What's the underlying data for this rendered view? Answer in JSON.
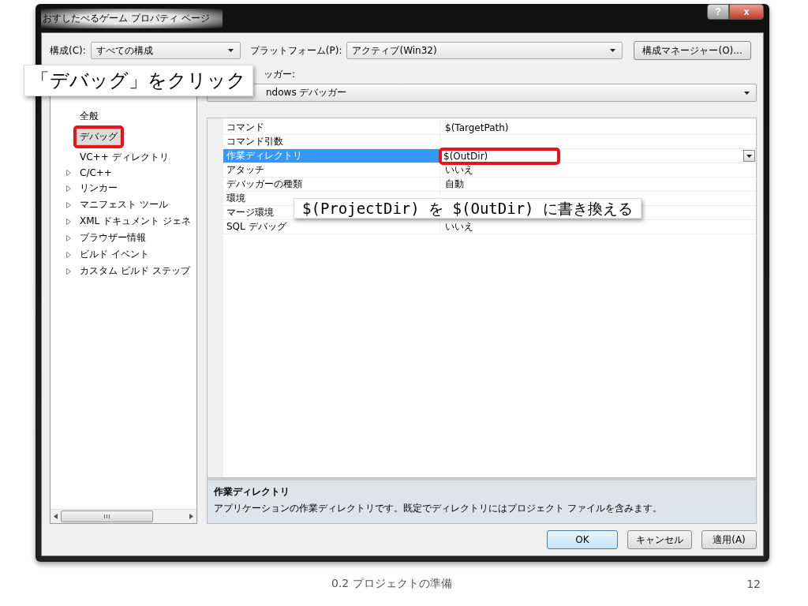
{
  "window": {
    "title": "おすしたべるゲーム プロパティ ページ",
    "controls": [
      {
        "kind": "help",
        "label": "?"
      },
      {
        "kind": "close",
        "label": "x"
      }
    ]
  },
  "toolbar": {
    "config_label": "構成(C):",
    "config_value": "すべての構成",
    "platform_label": "プラットフォーム(P):",
    "platform_value": "アクティブ(Win32)",
    "manager_button": "構成マネージャー(O)..."
  },
  "debugger": {
    "label": "ッガー:",
    "value": "ndows デバッガー"
  },
  "tree": {
    "items": [
      {
        "label": "全般",
        "expandable": false,
        "selected": false,
        "highlighted": false
      },
      {
        "label": "デバッグ",
        "expandable": false,
        "selected": true,
        "highlighted": true
      },
      {
        "label": "VC++ ディレクトリ",
        "expandable": false,
        "selected": false,
        "highlighted": false
      },
      {
        "label": "C/C++",
        "expandable": true,
        "selected": false,
        "highlighted": false
      },
      {
        "label": "リンカー",
        "expandable": true,
        "selected": false,
        "highlighted": false
      },
      {
        "label": "マニフェスト ツール",
        "expandable": true,
        "selected": false,
        "highlighted": false
      },
      {
        "label": "XML ドキュメント ジェネ",
        "expandable": true,
        "selected": false,
        "highlighted": false
      },
      {
        "label": "ブラウザー情報",
        "expandable": true,
        "selected": false,
        "highlighted": false
      },
      {
        "label": "ビルド イベント",
        "expandable": true,
        "selected": false,
        "highlighted": false
      },
      {
        "label": "カスタム ビルド ステップ",
        "expandable": true,
        "selected": false,
        "highlighted": false
      }
    ]
  },
  "properties": [
    {
      "name": "コマンド",
      "value": "$(TargetPath)",
      "selected": false,
      "highlighted": false
    },
    {
      "name": "コマンド引数",
      "selected": false,
      "highlighted": false
    },
    {
      "name": "作業ディレクトリ",
      "value": "$(OutDir)",
      "selected": true,
      "highlighted": true
    },
    {
      "name": "アタッチ",
      "value": "いいえ",
      "selected": false,
      "highlighted": false
    },
    {
      "name": "デバッガーの種類",
      "value": "自動",
      "selected": false,
      "highlighted": false
    },
    {
      "name": "環境",
      "selected": false,
      "highlighted": false
    },
    {
      "name": "マージ環境",
      "selected": false,
      "highlighted": false
    },
    {
      "name": "SQL デバッグ",
      "value": "いいえ",
      "selected": false,
      "highlighted": false
    }
  ],
  "description": {
    "title": "作業ディレクトリ",
    "text": "アプリケーションの作業ディレクトリです。既定でディレクトリにはプロジェクト ファイルを含みます。"
  },
  "buttons": [
    {
      "label": "OK",
      "default": true
    },
    {
      "label": "キャンセル",
      "default": false
    },
    {
      "label": "適用(A)",
      "default": false
    }
  ],
  "callouts": [
    {
      "kind": "upper",
      "text": "「デバッグ」をクリック"
    },
    {
      "kind": "lower",
      "text": "$(ProjectDir) を $(OutDir) に書き換える"
    }
  ],
  "footer": {
    "title": "0.2 プロジェクトの準備",
    "page": "12"
  }
}
